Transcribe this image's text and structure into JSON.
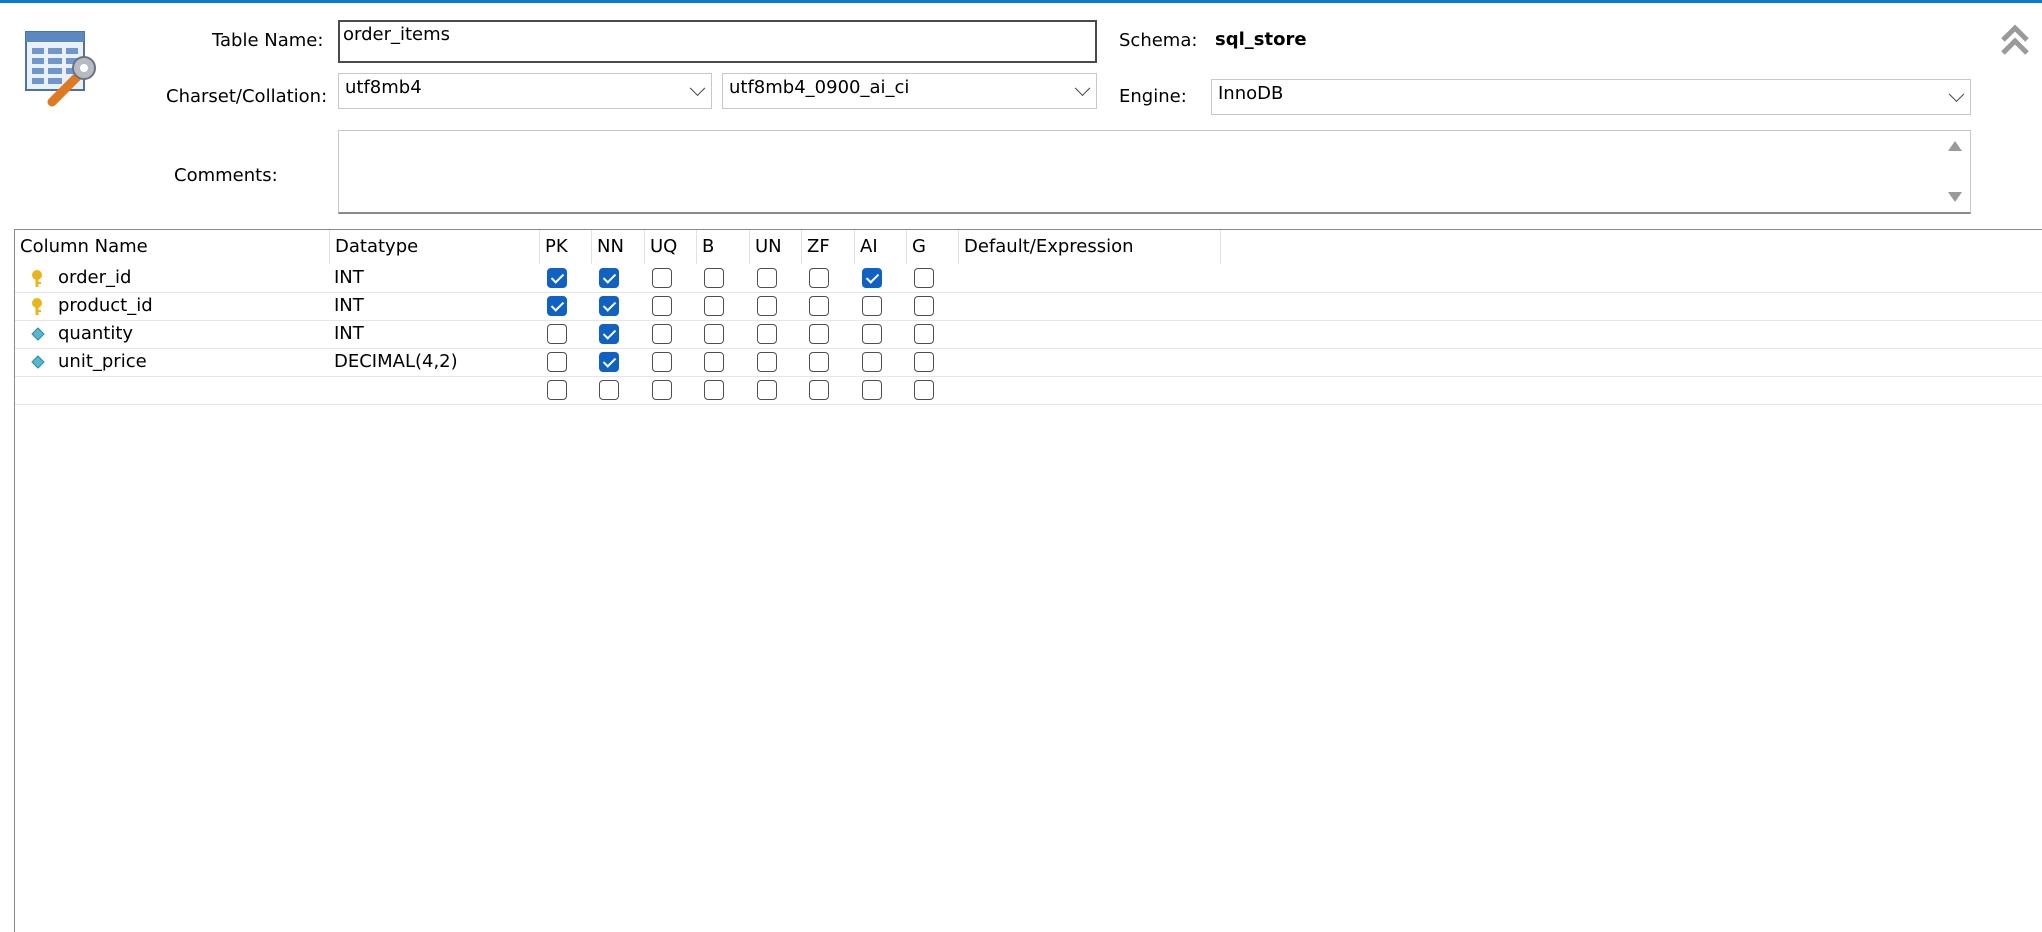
{
  "header": {
    "table_name_label": "Table Name:",
    "table_name_value": "order_items",
    "schema_label": "Schema:",
    "schema_value": "sql_store",
    "charset_label": "Charset/Collation:",
    "charset_value": "utf8mb4",
    "collation_value": "utf8mb4_0900_ai_ci",
    "engine_label": "Engine:",
    "engine_value": "InnoDB",
    "comments_label": "Comments:",
    "comments_value": ""
  },
  "grid": {
    "headers": {
      "column_name": "Column Name",
      "datatype": "Datatype",
      "pk": "PK",
      "nn": "NN",
      "uq": "UQ",
      "b": "B",
      "un": "UN",
      "zf": "ZF",
      "ai": "AI",
      "g": "G",
      "default": "Default/Expression"
    },
    "rows": [
      {
        "name": "order_id",
        "type": "INT",
        "icon": "primary-key-icon",
        "flags": {
          "pk": true,
          "nn": true,
          "uq": false,
          "b": false,
          "un": false,
          "zf": false,
          "ai": true,
          "g": false
        },
        "default": ""
      },
      {
        "name": "product_id",
        "type": "INT",
        "icon": "primary-key-icon",
        "flags": {
          "pk": true,
          "nn": true,
          "uq": false,
          "b": false,
          "un": false,
          "zf": false,
          "ai": false,
          "g": false
        },
        "default": ""
      },
      {
        "name": "quantity",
        "type": "INT",
        "icon": "column-diamond-icon",
        "flags": {
          "pk": false,
          "nn": true,
          "uq": false,
          "b": false,
          "un": false,
          "zf": false,
          "ai": false,
          "g": false
        },
        "default": ""
      },
      {
        "name": "unit_price",
        "type": "DECIMAL(4,2)",
        "icon": "column-diamond-icon",
        "flags": {
          "pk": false,
          "nn": true,
          "uq": false,
          "b": false,
          "un": false,
          "zf": false,
          "ai": false,
          "g": false
        },
        "default": ""
      },
      {
        "name": "",
        "type": "",
        "icon": "",
        "flags": {
          "pk": false,
          "nn": false,
          "uq": false,
          "b": false,
          "un": false,
          "zf": false,
          "ai": false,
          "g": false
        },
        "default": ""
      }
    ]
  },
  "colors": {
    "accent": "#0a78d4",
    "checkbox_checked": "#0f62c4",
    "key_icon": "#e8b61a",
    "diamond_icon": "#53b9cf"
  }
}
